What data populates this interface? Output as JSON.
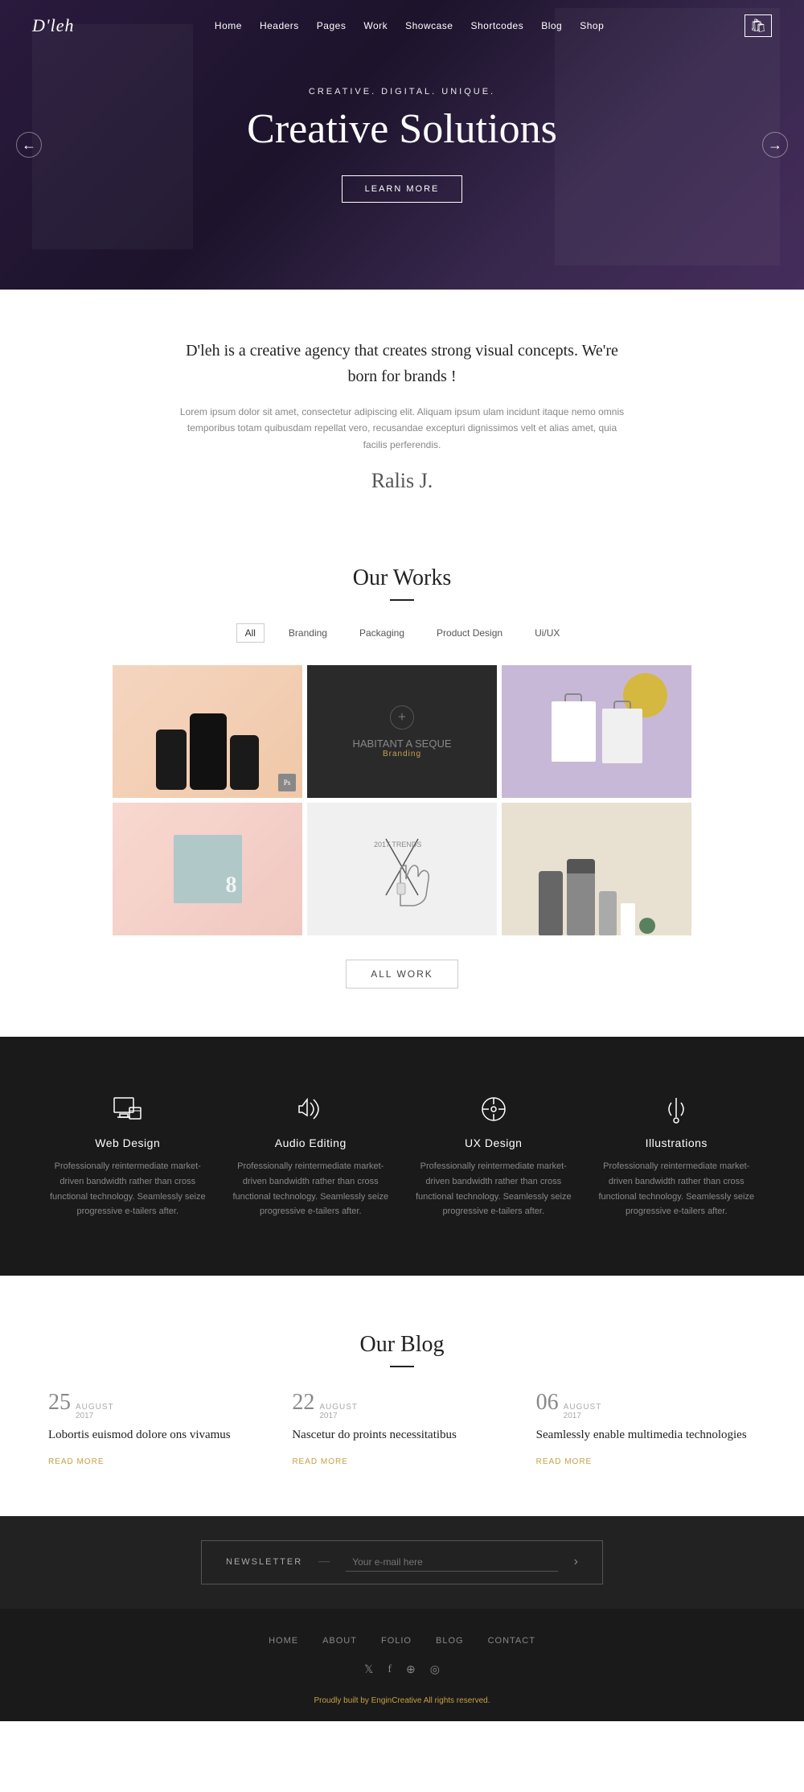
{
  "navbar": {
    "logo": "D'leh",
    "menu": [
      {
        "label": "Home",
        "id": "home"
      },
      {
        "label": "Headers",
        "id": "headers"
      },
      {
        "label": "Pages",
        "id": "pages"
      },
      {
        "label": "Work",
        "id": "work"
      },
      {
        "label": "Showcase",
        "id": "showcase"
      },
      {
        "label": "Shortcodes",
        "id": "shortcodes"
      },
      {
        "label": "Blog",
        "id": "blog"
      },
      {
        "label": "Shop",
        "id": "shop"
      }
    ]
  },
  "hero": {
    "subtitle": "CREATIVE. DIGITAL. UNIQUE.",
    "title": "Creative Solutions",
    "btn_label": "LEARN MORE",
    "arrow_left": "←",
    "arrow_right": "→"
  },
  "intro": {
    "headline": "D'leh is a creative agency that creates strong visual\nconcepts. We're born for brands !",
    "text": "Lorem ipsum dolor sit amet, consectetur adipiscing elit. Aliquam ipsum ulam incidunt itaque\nnemo omnis temporibus totam quibusdam repellat vero, recusandae excepturi dignissimos\nvelt et alias amet, quia facilis perferendis.",
    "signature": "Ralis J."
  },
  "works": {
    "section_title": "Our Works",
    "filters": [
      {
        "label": "All",
        "active": true
      },
      {
        "label": "Branding",
        "active": false
      },
      {
        "label": "Packaging",
        "active": false
      },
      {
        "label": "Product Design",
        "active": false
      },
      {
        "label": "Ui/UX",
        "active": false
      }
    ],
    "item2_label": "HABITANT A SEQUE",
    "item2_sublabel": "Branding",
    "all_work_btn": "ALL WORK"
  },
  "services": {
    "section_bg": "#1a1a1a",
    "items": [
      {
        "id": "web-design",
        "title": "Web Design",
        "text": "Professionally reintermediate market-driven bandwidth rather than cross functional technology. Seamlessly seize progressive e-tailers after."
      },
      {
        "id": "audio-editing",
        "title": "Audio Editing",
        "text": "Professionally reintermediate market-driven bandwidth rather than cross functional technology. Seamlessly seize progressive e-tailers after."
      },
      {
        "id": "ux-design",
        "title": "UX Design",
        "text": "Professionally reintermediate market-driven bandwidth rather than cross functional technology. Seamlessly seize progressive e-tailers after."
      },
      {
        "id": "illustrations",
        "title": "Illustrations",
        "text": "Professionally reintermediate market-driven bandwidth rather than cross functional technology. Seamlessly seize progressive e-tailers after."
      }
    ]
  },
  "blog": {
    "section_title": "Our Blog",
    "posts": [
      {
        "day": "25",
        "month": "AUGUST",
        "year": "2017",
        "title": "Lobortis euismod dolore ons vivamus",
        "read_more": "Read More"
      },
      {
        "day": "22",
        "month": "AUGUST",
        "year": "2017",
        "title": "Nascetur do proints necessitatibus",
        "read_more": "Read More"
      },
      {
        "day": "06",
        "month": "AUGUST",
        "year": "2017",
        "title": "Seamlessly enable multimedia technologies",
        "read_more": "Read More"
      }
    ]
  },
  "newsletter": {
    "label": "NEWSLETTER",
    "divider": "—",
    "placeholder": "Your e-mail here",
    "submit_arrow": "›"
  },
  "footer": {
    "menu": [
      {
        "label": "HOME"
      },
      {
        "label": "ABOUT"
      },
      {
        "label": "FOLIO"
      },
      {
        "label": "BLOG"
      },
      {
        "label": "CONTACT"
      }
    ],
    "social": [
      "𝕏",
      "f",
      "☁",
      "📷"
    ],
    "copy": "Proudly built by",
    "copy_brand": "EnginCreative",
    "copy_rights": "All rights reserved."
  }
}
